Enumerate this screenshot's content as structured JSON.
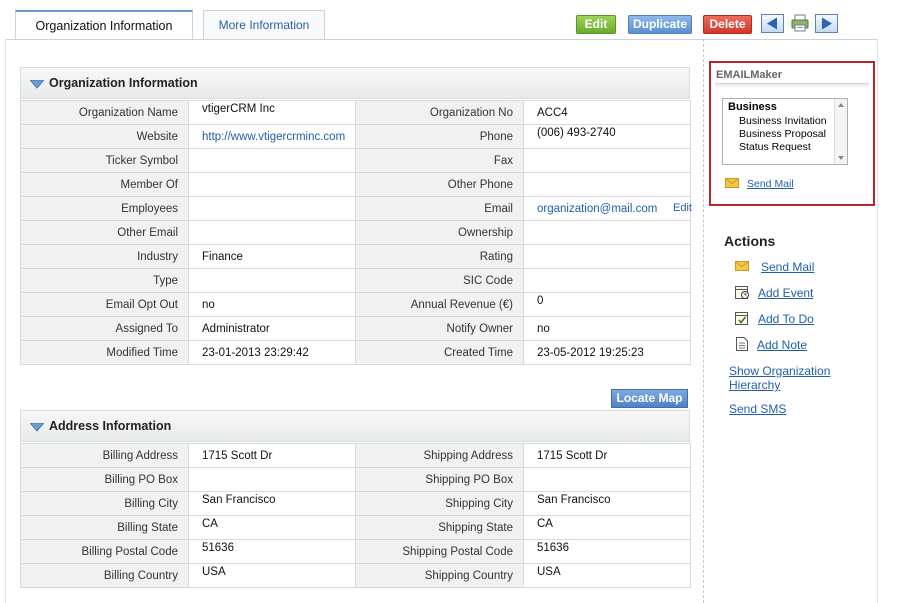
{
  "tabs": [
    {
      "label": "Organization Information",
      "active": true
    },
    {
      "label": "More Information",
      "active": false
    }
  ],
  "toolbar": {
    "edit_label": "Edit",
    "duplicate_label": "Duplicate",
    "delete_label": "Delete",
    "edit_color": "#7dbb3c",
    "duplicate_color": "#6b9ad8",
    "delete_color": "#e04a3c"
  },
  "org_section": {
    "title": "Organization Information",
    "edit_link": "Edit",
    "rows": [
      {
        "l1": "Organization Name",
        "v1": "vtigerCRM Inc",
        "l2": "Organization No",
        "v2": "ACC4"
      },
      {
        "l1": "Website",
        "v1": "http://www.vtigercrminc.com",
        "l2": "Phone",
        "v2": "(006) 493-2740"
      },
      {
        "l1": "Ticker Symbol",
        "v1": "",
        "l2": "Fax",
        "v2": ""
      },
      {
        "l1": "Member Of",
        "v1": "",
        "l2": "Other Phone",
        "v2": ""
      },
      {
        "l1": "Employees",
        "v1": "",
        "l2": "Email",
        "v2": "organization@mail.com"
      },
      {
        "l1": "Other Email",
        "v1": "",
        "l2": "Ownership",
        "v2": ""
      },
      {
        "l1": "Industry",
        "v1": "Finance",
        "l2": "Rating",
        "v2": ""
      },
      {
        "l1": "Type",
        "v1": "",
        "l2": "SIC Code",
        "v2": ""
      },
      {
        "l1": "Email Opt Out",
        "v1": "no",
        "l2": "Annual Revenue (€)",
        "v2": "0"
      },
      {
        "l1": "Assigned To",
        "v1": "Administrator",
        "l2": "Notify Owner",
        "v2": "no"
      },
      {
        "l1": "Modified Time",
        "v1": "23-01-2013 23:29:42",
        "l2": "Created Time",
        "v2": "23-05-2012 19:25:23"
      }
    ]
  },
  "locate_map_label": "Locate Map",
  "address_section": {
    "title": "Address Information",
    "rows": [
      {
        "l1": "Billing Address",
        "v1": "1715 Scott Dr",
        "l2": "Shipping Address",
        "v2": "1715 Scott Dr"
      },
      {
        "l1": "Billing PO Box",
        "v1": "",
        "l2": "Shipping PO Box",
        "v2": ""
      },
      {
        "l1": "Billing City",
        "v1": "San Francisco",
        "l2": "Shipping City",
        "v2": "San Francisco"
      },
      {
        "l1": "Billing State",
        "v1": "CA",
        "l2": "Shipping State",
        "v2": "CA"
      },
      {
        "l1": "Billing Postal Code",
        "v1": "51636",
        "l2": "Shipping Postal Code",
        "v2": "51636"
      },
      {
        "l1": "Billing Country",
        "v1": "USA",
        "l2": "Shipping Country",
        "v2": "USA"
      }
    ]
  },
  "emailmaker": {
    "title": "EMAILMaker",
    "group": "Business",
    "options": [
      "Business Invitation",
      "Business Proposal",
      "Status Request"
    ],
    "send_mail": "Send Mail",
    "highlight_color": "#b4272a"
  },
  "actions": {
    "title": "Actions",
    "items": [
      {
        "label": "Send Mail",
        "icon": "envelope-icon"
      },
      {
        "label": "Add Event",
        "icon": "calendar-event-icon"
      },
      {
        "label": "Add To Do",
        "icon": "todo-icon"
      },
      {
        "label": "Add Note",
        "icon": "note-icon"
      }
    ],
    "show_hierarchy": "Show Organization Hierarchy",
    "show_hierarchy_line1": "Show Organization",
    "show_hierarchy_line2": "Hierarchy",
    "send_sms": "Send SMS"
  }
}
